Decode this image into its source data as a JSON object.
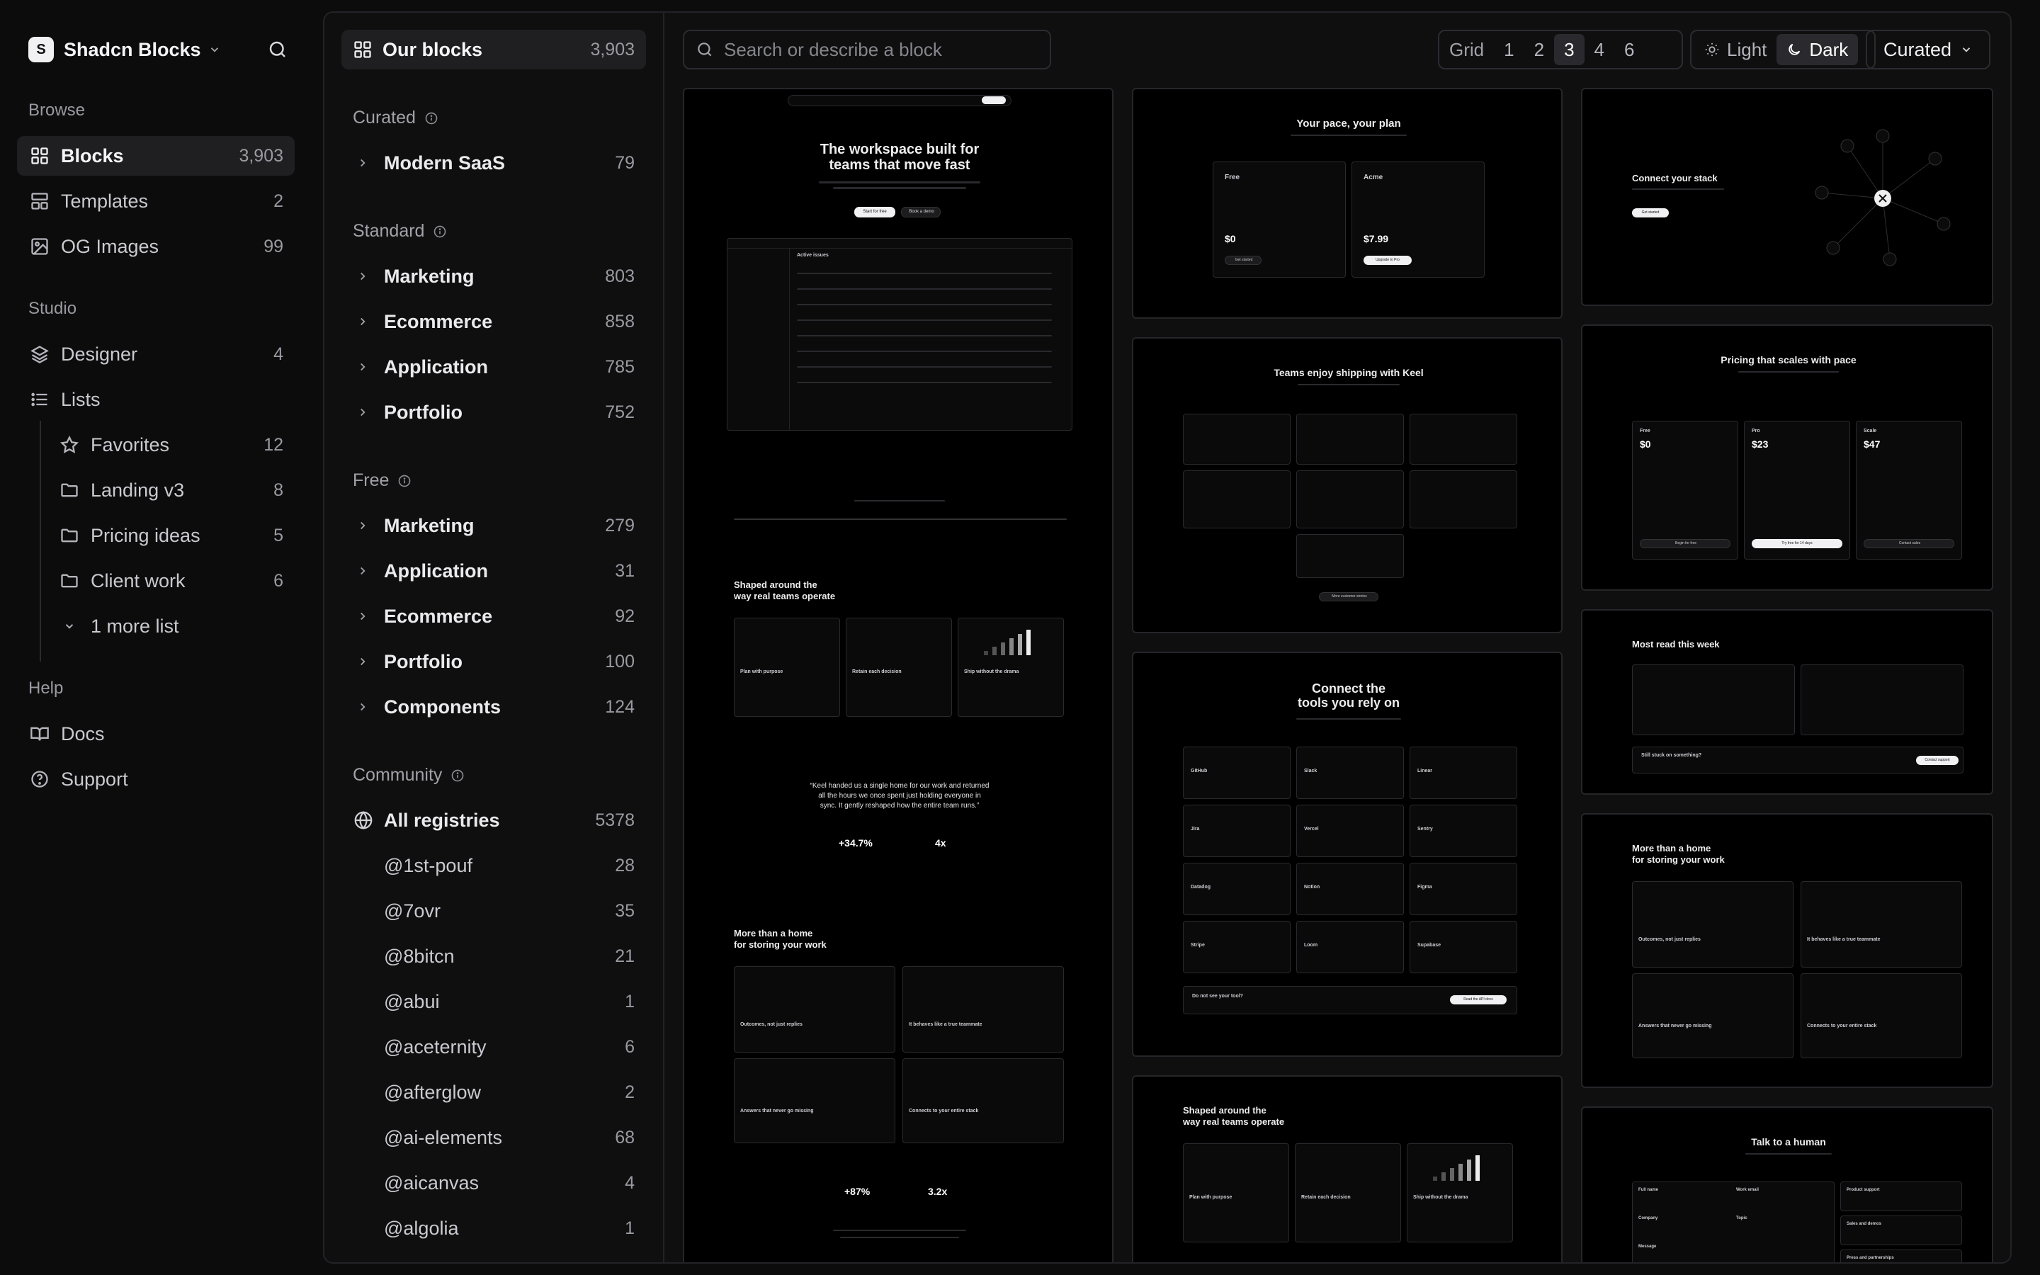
{
  "nav": {
    "brand": "Shadcn Blocks",
    "browse_label": "Browse",
    "blocks": {
      "label": "Blocks",
      "count": "3,903"
    },
    "templates": {
      "label": "Templates",
      "count": "2"
    },
    "og_images": {
      "label": "OG Images",
      "count": "99"
    },
    "studio_label": "Studio",
    "designer": {
      "label": "Designer",
      "count": "4"
    },
    "lists": {
      "label": "Lists"
    },
    "favorites": {
      "label": "Favorites",
      "count": "12"
    },
    "landing": {
      "label": "Landing v3",
      "count": "8"
    },
    "pricing_ideas": {
      "label": "Pricing ideas",
      "count": "5"
    },
    "client_work": {
      "label": "Client work",
      "count": "6"
    },
    "more_lists": "1 more list",
    "help_label": "Help",
    "docs": "Docs",
    "support": "Support"
  },
  "cats": {
    "our_blocks": {
      "label": "Our blocks",
      "count": "3,903"
    },
    "curated": "Curated",
    "modern_saas": {
      "label": "Modern SaaS",
      "count": "79"
    },
    "standard": "Standard",
    "std_items": [
      {
        "label": "Marketing",
        "count": "803"
      },
      {
        "label": "Ecommerce",
        "count": "858"
      },
      {
        "label": "Application",
        "count": "785"
      },
      {
        "label": "Portfolio",
        "count": "752"
      }
    ],
    "free": "Free",
    "free_items": [
      {
        "label": "Marketing",
        "count": "279"
      },
      {
        "label": "Application",
        "count": "31"
      },
      {
        "label": "Ecommerce",
        "count": "92"
      },
      {
        "label": "Portfolio",
        "count": "100"
      },
      {
        "label": "Components",
        "count": "124"
      }
    ],
    "community": "Community",
    "all_registries": {
      "label": "All registries",
      "count": "5378"
    },
    "registries": [
      {
        "label": "@1st-pouf",
        "count": "28"
      },
      {
        "label": "@7ovr",
        "count": "35"
      },
      {
        "label": "@8bitcn",
        "count": "21"
      },
      {
        "label": "@abui",
        "count": "1"
      },
      {
        "label": "@aceternity",
        "count": "6"
      },
      {
        "label": "@afterglow",
        "count": "2"
      },
      {
        "label": "@ai-elements",
        "count": "68"
      },
      {
        "label": "@aicanvas",
        "count": "4"
      },
      {
        "label": "@algolia",
        "count": "1"
      }
    ]
  },
  "toolbar": {
    "search_placeholder": "Search or describe a block",
    "grid_label": "Grid",
    "grid_options": [
      "1",
      "2",
      "3",
      "4",
      "6"
    ],
    "grid_selected": "3",
    "light": "Light",
    "dark": "Dark",
    "theme_selected": "Dark",
    "curated": "Curated"
  },
  "previews": {
    "hero": {
      "title_1": "The workspace built for",
      "title_2": "teams that move fast",
      "primary": "Start for free",
      "secondary": "Book a demo",
      "inbox": "Active issues",
      "feat_title_1": "Shaped around the",
      "feat_title_2": "way real teams operate",
      "feat_cards": [
        "Plan with purpose",
        "Retain each decision",
        "Ship without the drama"
      ],
      "quote_1": "“Keel handed us a single home for our work and returned",
      "quote_2": "all the hours we once spent just holding everyone in",
      "quote_3": "sync. It gently reshaped how the entire team runs.”",
      "stat1": "+34.7%",
      "stat2": "4x",
      "home_title_1": "More than a home",
      "home_title_2": "for storing your work",
      "home_cards": [
        "Outcomes, not just replies",
        "It behaves like a true teammate",
        "Answers that never go missing",
        "Connects to your entire stack"
      ],
      "stat3": "+87%",
      "stat4": "3.2x"
    },
    "pace": {
      "title": "Your pace, your plan",
      "free": "Free",
      "acme": "Acme",
      "price_free": "$0",
      "price_acme": "$7.99",
      "get_started": "Get started",
      "upgrade": "Upgrade to Pro"
    },
    "teams": {
      "title": "Teams enjoy shipping with Keel",
      "more": "More customer stories"
    },
    "connect": {
      "title_1": "Connect the",
      "title_2": "tools you rely on",
      "tools": [
        "GitHub",
        "Slack",
        "Linear",
        "Jira",
        "Vercel",
        "Sentry",
        "Datadog",
        "Notion",
        "Figma",
        "Stripe",
        "Loom",
        "Supabase"
      ],
      "cta_text": "Do not see your tool?",
      "cta_btn": "Read the API docs"
    },
    "shaped2": {
      "title_1": "Shaped around the",
      "title_2": "way real teams operate",
      "cards": [
        "Plan with purpose",
        "Retain each decision",
        "Ship without the drama"
      ]
    },
    "stack": {
      "title": "Connect your stack",
      "btn": "Get started"
    },
    "pricing": {
      "title": "Pricing that scales with pace",
      "tiers": [
        {
          "name": "Free",
          "price": "$0",
          "btn": "Begin for free"
        },
        {
          "name": "Pro",
          "price": "$23",
          "btn": "Try free for 14 days"
        },
        {
          "name": "Scale",
          "price": "$47",
          "btn": "Contact sales"
        }
      ]
    },
    "most_read": {
      "title": "Most read this week",
      "cta": "Still stuck on something?",
      "cta_btn": "Contact support"
    },
    "home2": {
      "title_1": "More than a home",
      "title_2": "for storing your work",
      "cards": [
        "Outcomes, not just replies",
        "It behaves like a true teammate",
        "Answers that never go missing",
        "Connects to your entire stack"
      ]
    },
    "talk": {
      "title": "Talk to a human",
      "fields": [
        "Full name",
        "Work email",
        "Company",
        "Topic",
        "Message"
      ],
      "side": [
        "Product support",
        "Sales and demos",
        "Press and partnerships"
      ]
    }
  }
}
